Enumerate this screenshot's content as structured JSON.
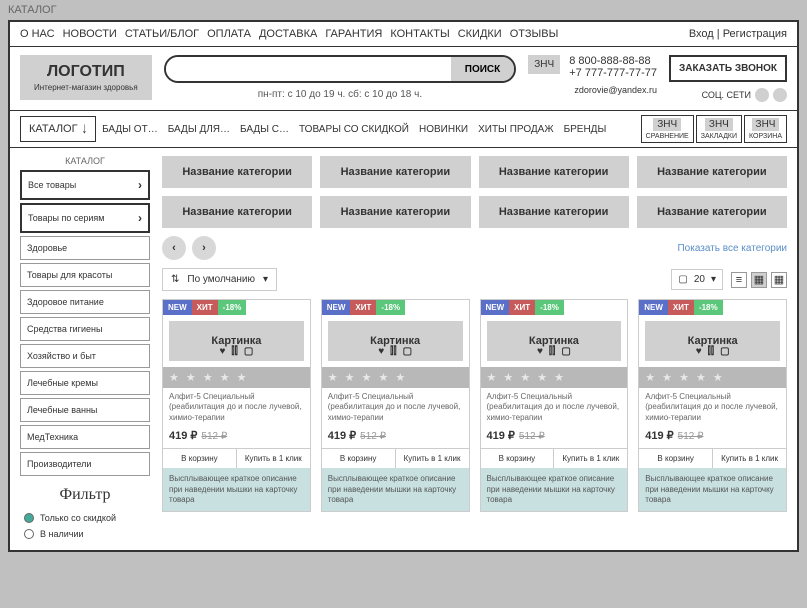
{
  "page_label": "КАТАЛОГ",
  "topnav": [
    "О НАС",
    "НОВОСТИ",
    "СТАТЬИ/БЛОГ",
    "ОПЛАТА",
    "ДОСТАВКА",
    "ГАРАНТИЯ",
    "КОНТАКТЫ",
    "СКИДКИ",
    "ОТЗЫВЫ"
  ],
  "auth": {
    "login": "Вход",
    "sep": " | ",
    "register": "Регистрация"
  },
  "logo": {
    "title": "ЛОГОТИП",
    "sub": "Интернет-магазин здоровья"
  },
  "search": {
    "placeholder": "",
    "button": "ПОИСК"
  },
  "hours": "пн-пт: с 10 до 19 ч.     сб: с 10 до 18 ч.",
  "phones": {
    "znch": "ЗНЧ",
    "p1": "8 800-888-88-88",
    "p2": "+7 777-777-77-77",
    "email": "zdorovie@yandex.ru"
  },
  "call_btn": "ЗАКАЗАТЬ ЗВОНОК",
  "social_label": "СОЦ. СЕТИ",
  "catalog_btn": "КАТАЛОГ",
  "mainnav": [
    "БАДЫ ОТ…",
    "БАДЫ ДЛЯ…",
    "БАДЫ С…",
    "ТОВАРЫ СО СКИДКОЙ",
    "НОВИНКИ",
    "ХИТЫ ПРОДАЖ",
    "БРЕНДЫ"
  ],
  "icon_boxes": [
    {
      "z": "ЗНЧ",
      "l": "СРАВНЕНИЕ"
    },
    {
      "z": "ЗНЧ",
      "l": "ЗАКЛАДКИ"
    },
    {
      "z": "ЗНЧ",
      "l": "КОРЗИНА"
    }
  ],
  "sidebar_title": "КАТАЛОГ",
  "sidebar": [
    "Все товары",
    "Товары по сериям",
    "Здоровье",
    "Товары для красоты",
    "Здоровое питание",
    "Средства гигиены",
    "Хозяйство и быт",
    "Лечебные кремы",
    "Лечебные ванны",
    "МедТехника",
    "Производители"
  ],
  "filter": {
    "title": "Фильтр",
    "opts": [
      "Только со скидкой",
      "В наличии"
    ]
  },
  "cat_tile": "Название категории",
  "show_all": "Показать все категории",
  "sort": {
    "label": "По умолчанию"
  },
  "pager": {
    "count": "20"
  },
  "product": {
    "badges": {
      "new": "NEW",
      "hit": "ХИТ",
      "disc": "-18%"
    },
    "img": "Картинка",
    "stars": "★ ★ ★ ★ ★",
    "name": "Алфит-5 Специальный (реабилитация до и после лучевой, химио-терапии",
    "price": "419 ₽",
    "old": "512 ₽",
    "cart": "В корзину",
    "oneclick": "Купить в 1 клик",
    "tooltip": "Высплывающее краткое описание при наведении мышки на карточку товара"
  }
}
